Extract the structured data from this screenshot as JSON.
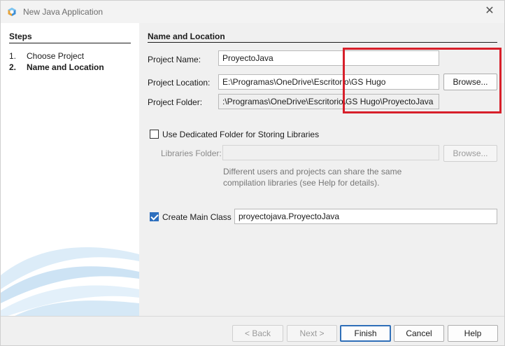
{
  "window": {
    "title": "New Java Application",
    "close_icon": "close-icon"
  },
  "steps": {
    "title": "Steps",
    "items": [
      {
        "num": "1.",
        "label": "Choose Project"
      },
      {
        "num": "2.",
        "label": "Name and Location"
      }
    ]
  },
  "form": {
    "section_title": "Name and Location",
    "project_name_label": "Project Name:",
    "project_name_value": "ProyectoJava",
    "project_location_label": "Project Location:",
    "project_location_value": "E:\\Programas\\OneDrive\\Escritorio\\GS Hugo",
    "project_location_browse": "Browse...",
    "project_folder_label": "Project Folder:",
    "project_folder_value": ":\\Programas\\OneDrive\\Escritorio\\GS Hugo\\ProyectoJava",
    "dedicated_folder_label": "Use Dedicated Folder for Storing Libraries",
    "dedicated_folder_checked": false,
    "libraries_folder_label": "Libraries Folder:",
    "libraries_folder_value": "",
    "libraries_browse": "Browse...",
    "libraries_help_line1": "Different users and projects can share the same",
    "libraries_help_line2": "compilation libraries (see Help for details).",
    "create_main_label": "Create Main Class",
    "create_main_checked": true,
    "main_class_value": "proyectojava.ProyectoJava"
  },
  "buttons": {
    "back": "< Back",
    "next": "Next >",
    "finish": "Finish",
    "cancel": "Cancel",
    "help": "Help"
  },
  "colors": {
    "highlight": "#d71f2a",
    "accent": "#2f6fb8"
  }
}
